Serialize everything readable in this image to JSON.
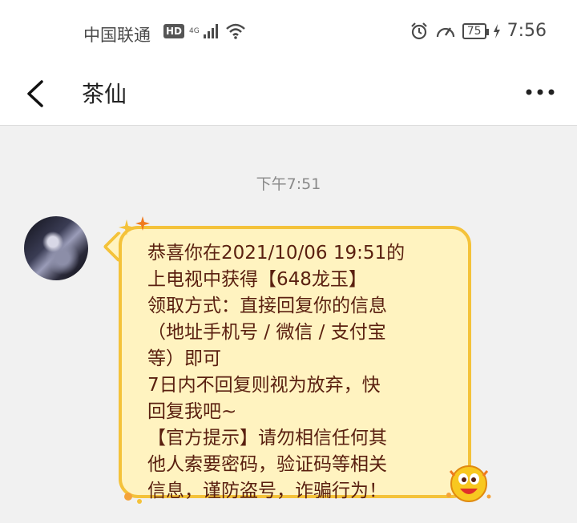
{
  "status_bar": {
    "carrier": "中国联通",
    "hd_label": "HD",
    "network_label": "4G",
    "battery_level": "75",
    "time": "7:56"
  },
  "nav": {
    "title": "茶仙"
  },
  "conversation": {
    "timestamp": "下午7:51",
    "message_lines": [
      "恭喜你在2021/10/06 19:51的",
      "上电视中获得【648龙玉】",
      "领取方式：直接回复你的信息",
      "（地址手机号 / 微信 / 支付宝",
      "等）即可",
      "7日内不回复则视为放弃，快",
      "回复我吧~",
      "【官方提示】请勿相信任何其",
      "他人索要密码，验证码等相关",
      "信息，谨防盗号，诈骗行为！"
    ]
  },
  "colors": {
    "bubble_fill": "#fff3c0",
    "bubble_border": "#f4c23a",
    "message_text": "#5a2010"
  }
}
